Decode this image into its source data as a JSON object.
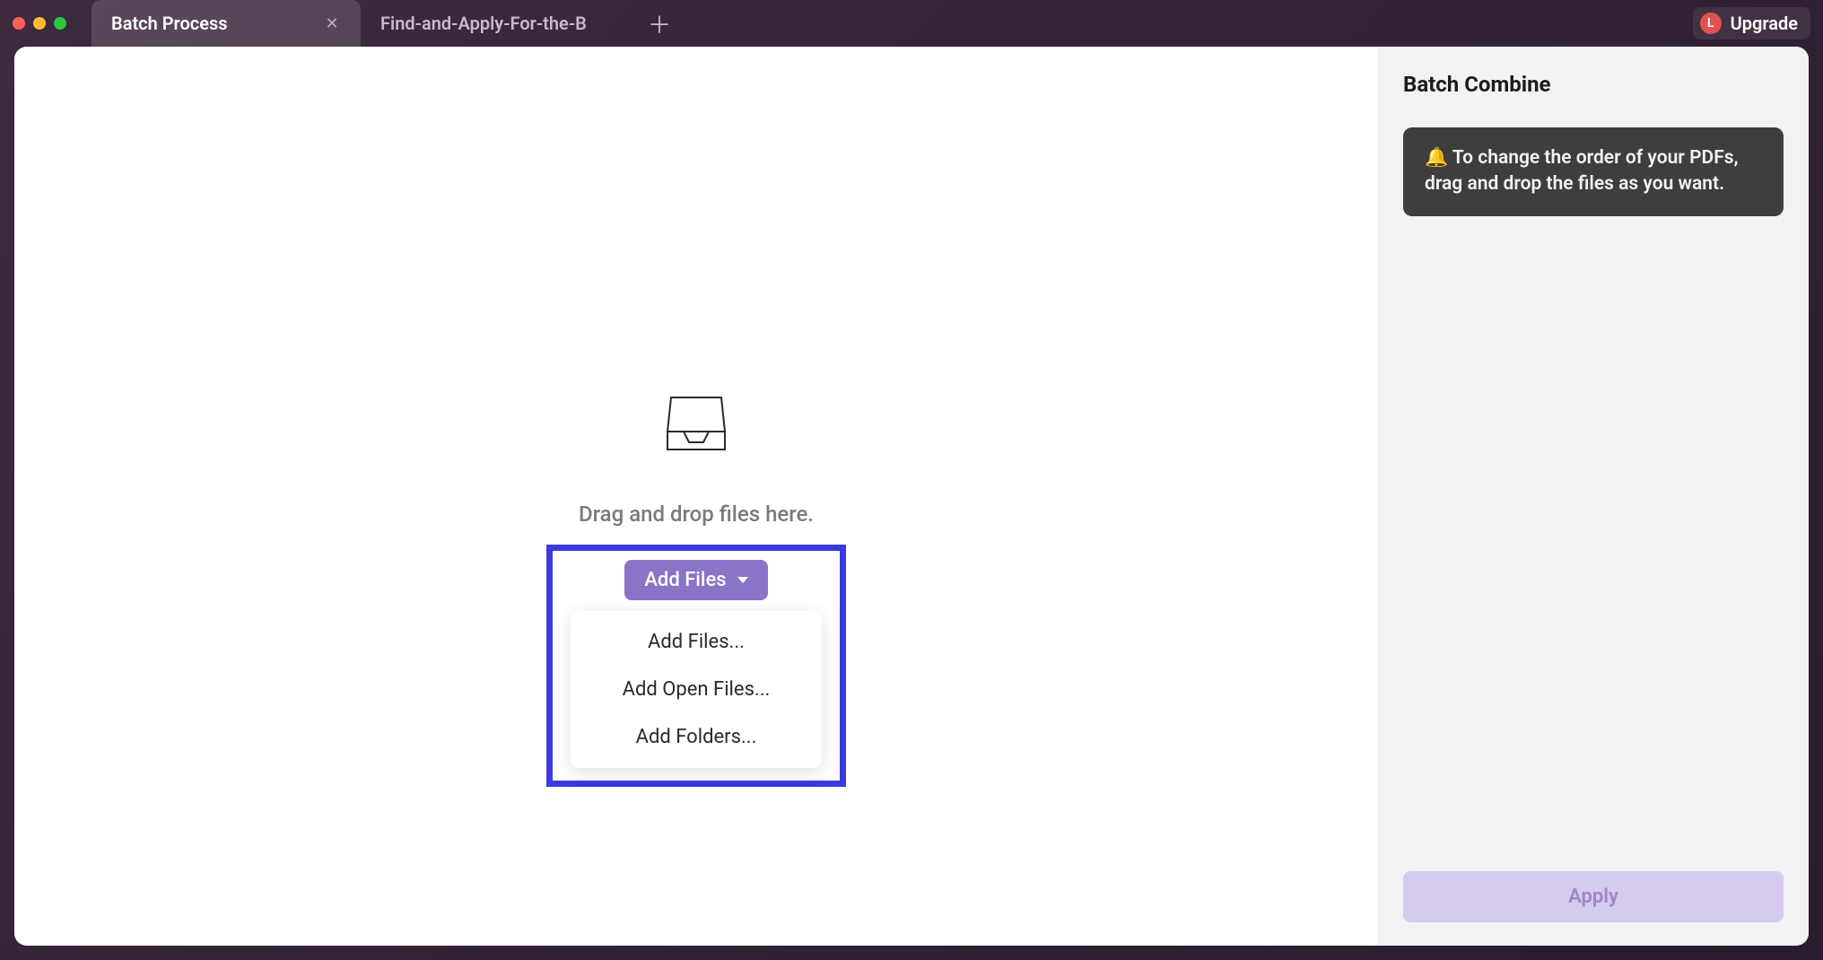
{
  "titlebar": {
    "tabs": [
      {
        "label": "Batch Process",
        "active": true
      },
      {
        "label": "Find-and-Apply-For-the-B",
        "active": false
      }
    ],
    "avatar_letter": "L",
    "upgrade_label": "Upgrade"
  },
  "main": {
    "drop_label": "Drag and drop files here.",
    "add_files_label": "Add Files",
    "menu_items": [
      "Add Files...",
      "Add Open Files...",
      "Add Folders..."
    ]
  },
  "sidebar": {
    "title": "Batch Combine",
    "tip_icon": "🔔",
    "tip_text": "To change the order of your PDFs, drag and drop the files as you want.",
    "apply_label": "Apply"
  }
}
